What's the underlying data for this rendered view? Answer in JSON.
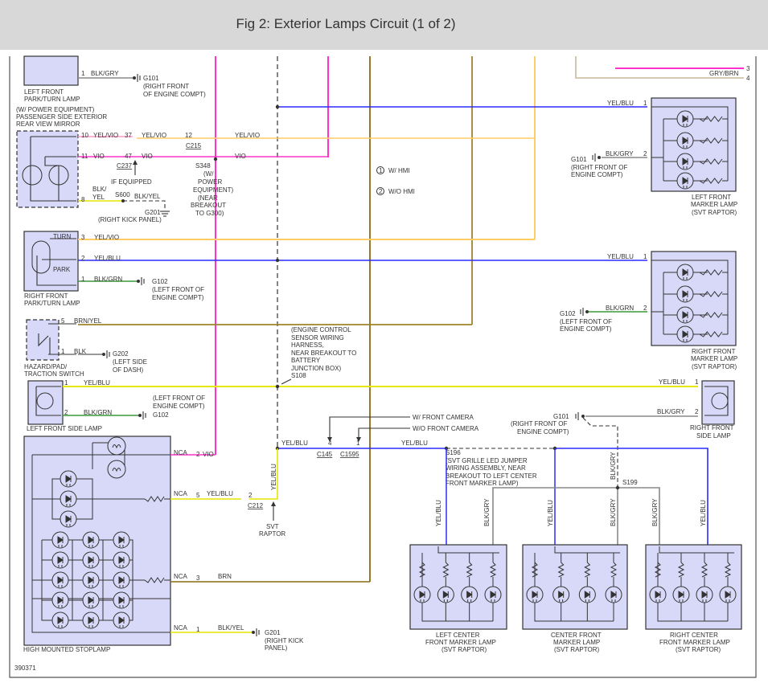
{
  "title": "Fig 2: Exterior Lamps Circuit (1 of 2)",
  "colors": {
    "VIO": "#ff33cc",
    "YEL_VIO": "#ffcc66",
    "YEL_BLU_blue": "#2b2bff",
    "YEL": "#e6e600",
    "BRN": "#8a6a10",
    "BRN_YEL": "#a08428",
    "BLK_GRY": "#888888",
    "BLK_GRN": "#3a9a3a",
    "GRY_BRN": "#c8b89a",
    "component_fill": "#d8d8f8",
    "titlebar": "#d8d8d8"
  },
  "components": {
    "left_front_park_turn": [
      "LEFT FRONT",
      "PARK/TURN LAMP"
    ],
    "mirror": [
      "(W/ POWER EQUIPMENT)",
      "PASSENGER SIDE EXTERIOR",
      "REAR VIEW MIRROR"
    ],
    "right_front_park_turn": [
      "RIGHT FRONT",
      "PARK/TURN LAMP"
    ],
    "turn": "TURN",
    "park": "PARK",
    "hazard_switch": [
      "HAZARD/PAD/",
      "TRACTION SWITCH"
    ],
    "left_front_side_lamp": "LEFT FRONT SIDE LAMP",
    "high_mounted_stoplamp": "HIGH MOUNTED STOPLAMP",
    "left_front_marker": [
      "LEFT FRONT",
      "MARKER LAMP",
      "(SVT RAPTOR)"
    ],
    "right_front_marker": [
      "RIGHT FRONT",
      "MARKER LAMP",
      "(SVT RAPTOR)"
    ],
    "right_front_side_lamp": [
      "RIGHT FRONT",
      "SIDE LAMP"
    ],
    "left_center_marker": [
      "LEFT CENTER",
      "FRONT MARKER LAMP",
      "(SVT RAPTOR)"
    ],
    "center_front_marker": [
      "CENTER FRONT",
      "MARKER LAMP",
      "(SVT RAPTOR)"
    ],
    "right_center_marker": [
      "RIGHT CENTER",
      "FRONT MARKER LAMP",
      "(SVT RAPTOR)"
    ]
  },
  "wires": {
    "blk_gry": "BLK/GRY",
    "yel_vio": "YEL/VIO",
    "vio": "VIO",
    "blk_yel_a": "BLK/",
    "blk_yel_b": "YEL",
    "blk_yel": "BLK/YEL",
    "yel_blu": "YEL/BLU",
    "blk_grn": "BLK/GRN",
    "brn_yel": "BRN/YEL",
    "blk": "BLK",
    "brn": "BRN",
    "gry_brn": "GRY/BRN",
    "nca": "NCA"
  },
  "pins": {
    "p1": "1",
    "p2": "2",
    "p3": "3",
    "p4": "4",
    "p5": "5",
    "p8": "8",
    "p10": "10",
    "p11": "11",
    "p12": "12",
    "p37": "37",
    "p47": "47"
  },
  "connectors": {
    "c237": "C237",
    "c215": "C215",
    "c145": "C145",
    "c1595": "C1595",
    "c212": "C212"
  },
  "grounds": {
    "g101": "G101",
    "g101_loc": [
      "(RIGHT FRONT",
      "OF ENGINE COMPT)"
    ],
    "g101_loc2": [
      "(RIGHT FRONT OF",
      "ENGINE COMPT)"
    ],
    "g201": "G201",
    "g201_loc": "(RIGHT KICK PANEL)",
    "g201_loc2": [
      "(RIGHT KICK",
      "PANEL)"
    ],
    "g102": "G102",
    "g102_loc": [
      "(LEFT FRONT OF",
      "ENGINE COMPT)"
    ],
    "g202": "G202",
    "g202_loc": [
      "(LEFT SIDE",
      "OF DASH)"
    ]
  },
  "splices": {
    "s348": "S348",
    "s348_note": [
      "(W/",
      "POWER",
      "EQUIPMENT)",
      "(NEAR",
      "BREAKOUT",
      "TO G300)"
    ],
    "s600": "S600",
    "s108": "S108",
    "s108_note": [
      "(ENGINE CONTROL",
      "SENSOR WIRING",
      "HARNESS,",
      "NEAR BREAKOUT TO",
      "BATTERY",
      "JUNCTION BOX)"
    ],
    "s196": "S196",
    "s196_note": [
      "(SVT GRILLE LED JUMPER",
      "WIRING ASSEMBLY, NEAR",
      "BREAKOUT TO LEFT CENTER",
      "FRONT MARKER LAMP)"
    ],
    "s199": "S199"
  },
  "notes": {
    "if_equipped": "IF EQUIPPED",
    "w_hmi": "W/ HMI",
    "wo_hmi": "W/O HMI",
    "hmi1": "1",
    "hmi2": "2",
    "w_camera": "W/ FRONT CAMERA",
    "wo_camera": "W/O FRONT CAMERA",
    "svt": "SVT",
    "raptor": "RAPTOR",
    "figure_id": "390371"
  }
}
